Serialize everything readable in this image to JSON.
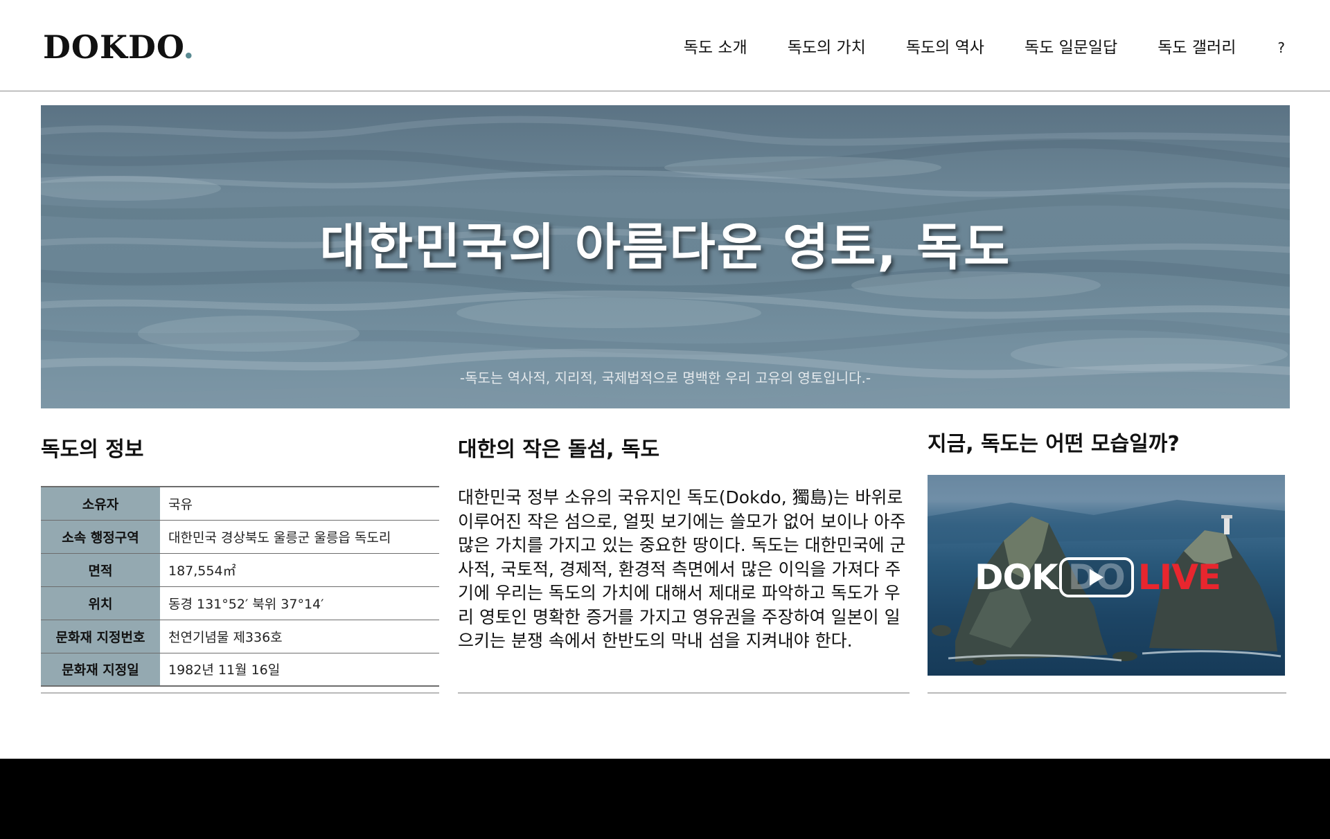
{
  "header": {
    "logo_text": "DOKDO",
    "logo_dot": ".",
    "logo_dot_color": "#5a8a92",
    "nav": [
      {
        "label": "독도 소개"
      },
      {
        "label": "독도의 가치"
      },
      {
        "label": "독도의 역사"
      },
      {
        "label": "독도 일문일답"
      },
      {
        "label": "독도 갤러리"
      },
      {
        "label": "?"
      }
    ]
  },
  "hero": {
    "title": "대한민국의 아름다운 영토, 독도",
    "subtitle": "-독도는 역사적, 지리적, 국제법적으로 명백한 우리 고유의 영토입니다.-"
  },
  "info": {
    "title": "독도의 정보",
    "rows": [
      {
        "label": "소유자",
        "value": "국유"
      },
      {
        "label": "소속 행정구역",
        "value": "대한민국 경상북도 울릉군 울릉읍 독도리"
      },
      {
        "label": "면적",
        "value": "187,554㎡"
      },
      {
        "label": "위치",
        "value": "동경 131°52′ 북위 37°14′"
      },
      {
        "label": "문화재 지정번호",
        "value": "천연기념물 제336호"
      },
      {
        "label": "문화재 지정일",
        "value": "1982년 11월 16일"
      }
    ],
    "header_color": "#94a9b1"
  },
  "about": {
    "title": "대한의 작은 돌섬, 독도",
    "body": "대한민국 정부 소유의 국유지인 독도(Dokdo, 獨島)는 바위로 이루어진 작은 섬으로, 얼핏 보기에는 쓸모가 없어 보이나 아주 많은 가치를 가지고 있는 중요한 땅이다. 독도는 대한민국에 군사적, 국토적, 경제적, 환경적 측면에서 많은 이익을 가져다 주기에 우리는 독도의 가치에 대해서 제대로 파악하고 독도가 우리 영토인 명확한 증거를 가지고 영유권을 주장하여 일본이 일으키는 분쟁 속에서 한반도의 막내 섬을 지켜내야 한다."
  },
  "live": {
    "title": "지금, 독도는 어떤 모습일까?",
    "logo_part1": "DOK",
    "logo_faded": "DO",
    "logo_part2": "LIVE",
    "accent_color": "#e8262e",
    "icon": "play-icon"
  },
  "footer": {
    "line1": "",
    "line2": ""
  }
}
